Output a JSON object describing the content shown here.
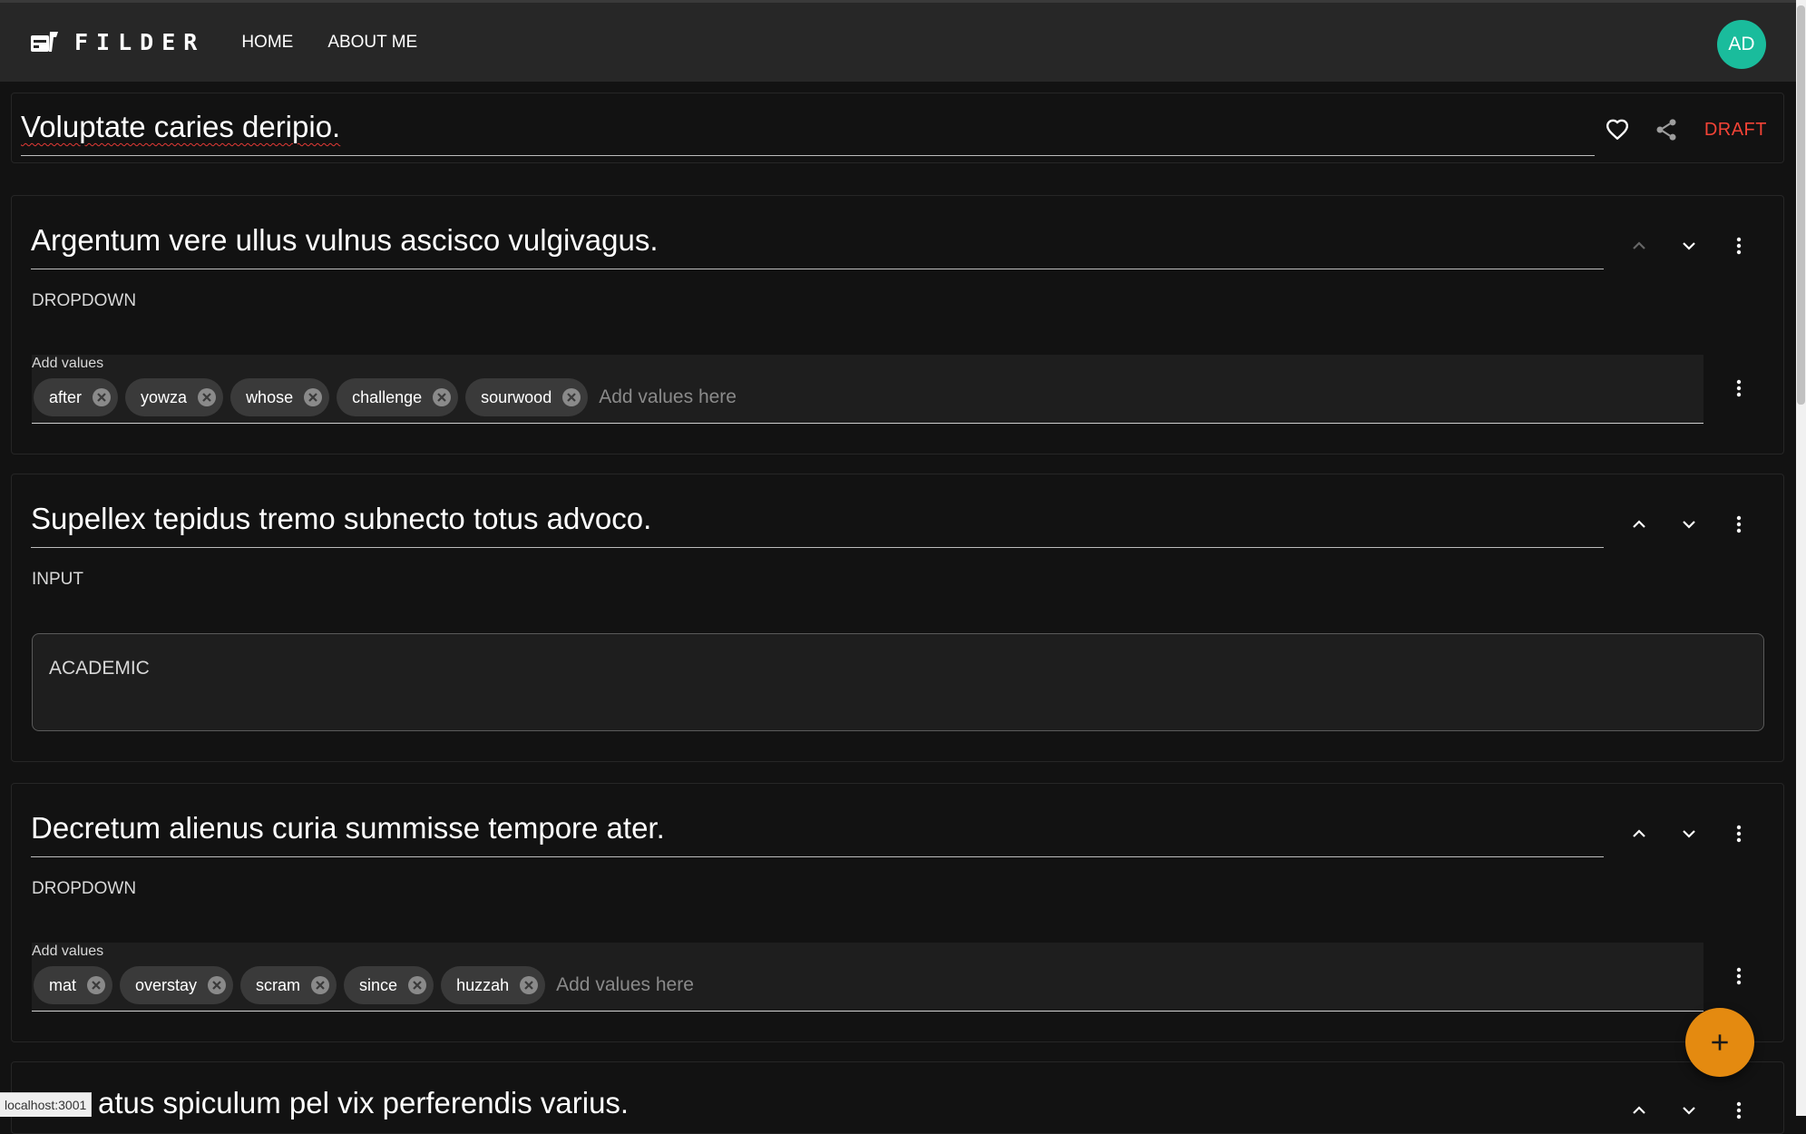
{
  "app": {
    "name": "FILDER",
    "avatar_initials": "AD"
  },
  "nav": {
    "home": "HOME",
    "about": "ABOUT ME"
  },
  "form": {
    "title": "Voluptate caries deripio.",
    "status": "DRAFT"
  },
  "questions": [
    {
      "title": "Argentum vere ullus vulnus ascisco vulgivagus.",
      "type": "DROPDOWN",
      "values_label": "Add values",
      "values": [
        "after",
        "yowza",
        "whose",
        "challenge",
        "sourwood"
      ],
      "placeholder": "Add values here"
    },
    {
      "title": "Supellex tepidus tremo subnecto totus advoco.",
      "type": "INPUT",
      "input_value": "ACADEMIC"
    },
    {
      "title": "Decretum alienus curia summisse tempore ater.",
      "type": "DROPDOWN",
      "values_label": "Add values",
      "values": [
        "mat",
        "overstay",
        "scram",
        "since",
        "huzzah"
      ],
      "placeholder": "Add values here"
    },
    {
      "title": "atus spiculum pel vix perferendis varius."
    }
  ],
  "status_bar_url": "localhost:3001",
  "colors": {
    "accent": "#e48a10",
    "avatar": "#1abc9c",
    "draft": "#f44336"
  },
  "icons": [
    "filder-logo-icon",
    "heart-outline-icon",
    "share-icon",
    "chevron-up-icon",
    "chevron-down-icon",
    "more-vert-icon",
    "cancel-circle-icon",
    "plus-icon"
  ]
}
